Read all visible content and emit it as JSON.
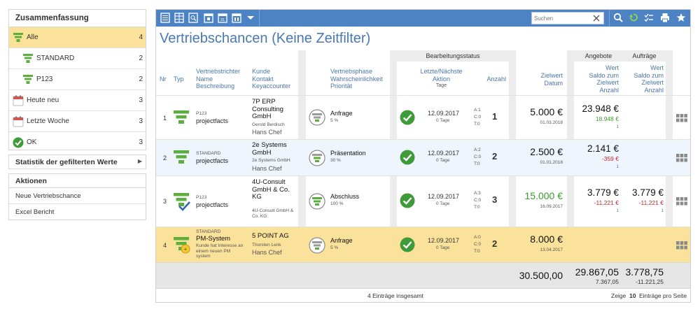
{
  "summary": {
    "title": "Zusammenfassung",
    "items": [
      {
        "label": "Alle",
        "count": "4"
      },
      {
        "label": "STANDARD",
        "count": "2"
      },
      {
        "label": "P123",
        "count": "2"
      },
      {
        "label": "Heute neu",
        "count": "3"
      },
      {
        "label": "Letzte Woche",
        "count": "3"
      },
      {
        "label": "OK",
        "count": "3"
      }
    ]
  },
  "stats": {
    "title": "Statistik der gefilterten Werte"
  },
  "actions": {
    "title": "Aktionen",
    "items": [
      "Neue Vertriebschance",
      "Excel Bericht"
    ]
  },
  "toolbar": {
    "search_placeholder": "Suchen"
  },
  "page_title": "Vertriebschancen (Keine Zeitfilter)",
  "groups": {
    "bearbeitungsstatus": "Bearbeitungsstatus",
    "angebote": "Angebote",
    "auftraege": "Aufträge"
  },
  "headers": {
    "nr": "Nr",
    "typ": "Typ",
    "vertrieb": [
      "Vertriebstrichter",
      "Name",
      "Beschreibung"
    ],
    "kunde": [
      "Kunde",
      "Kontakt",
      "Keyaccounter"
    ],
    "phase": [
      "Vertriebsphase",
      "Wahrscheinlichkeit",
      "Priorität"
    ],
    "aktion": [
      "Letzte/Nächste",
      "Aktion",
      "Tage"
    ],
    "anzahl": "Anzahl",
    "zielwert": [
      "Zielwert",
      "Datum"
    ],
    "angebote": [
      "Wert",
      "Saldo zum",
      "Zielwert",
      "Anzahl"
    ],
    "auftraege": [
      "Wert",
      "Saldo zum",
      "Zielwert",
      "Anzahl"
    ]
  },
  "rows": [
    {
      "nr": "1",
      "trichter": "P123",
      "name": "projectfacts",
      "beschreibung": "",
      "kunde": "7P ERP Consulting GmbH",
      "kontakt": "Gerold Berdisch",
      "keyaccounter": "Hans Chef",
      "phase": "Anfrage",
      "prob": "5 %",
      "date": "12.09.2017",
      "tage": "0 Tage",
      "abc": [
        "A:1",
        "C:0",
        "T:0"
      ],
      "anzahl": "1",
      "zielwert": "5.000 €",
      "zieldatum": "01.03.2018",
      "ang_wert": "23.948 €",
      "ang_saldo": "18.948 €",
      "ang_anzahl": "1",
      "auf_wert": "",
      "auf_saldo": "",
      "auf_anzahl": ""
    },
    {
      "nr": "2",
      "trichter": "STANDARD",
      "name": "projectfacts",
      "beschreibung": "",
      "kunde": "2e Systems GmbH",
      "kontakt": "2e Systems GmbH",
      "keyaccounter": "Hans Chef",
      "phase": "Präsentation",
      "prob": "30 %",
      "date": "12.09.2017",
      "tage": "0 Tage",
      "abc": [
        "A:2",
        "C:0",
        "T:0"
      ],
      "anzahl": "2",
      "zielwert": "2.500 €",
      "zieldatum": "01.01.2018",
      "ang_wert": "2.141 €",
      "ang_saldo": "-359 €",
      "ang_anzahl": "1",
      "auf_wert": "",
      "auf_saldo": "",
      "auf_anzahl": ""
    },
    {
      "nr": "3",
      "trichter": "P123",
      "name": "projectfacts",
      "beschreibung": "",
      "kunde": "4U-Consult GmbH & Co. KG",
      "kontakt": "4U-Consult GmbH & Co. KG",
      "keyaccounter": "",
      "phase": "Abschluss",
      "prob": "100 %",
      "date": "12.09.2017",
      "tage": "0 Tage",
      "abc": [
        "A:3",
        "C:0",
        "T:0"
      ],
      "anzahl": "3",
      "zielwert": "15.000 €",
      "zieldatum": "16.09.2017",
      "ang_wert": "3.779 €",
      "ang_saldo": "-11.221 €",
      "ang_anzahl": "1",
      "auf_wert": "3.779 €",
      "auf_saldo": "-11.221 €",
      "auf_anzahl": "1"
    },
    {
      "nr": "4",
      "trichter": "STANDARD",
      "name": "PM-System",
      "beschreibung": "Kunde hat Interesse an einem neuen PM system",
      "kunde": "5 POINT AG",
      "kontakt": "Thorsten Lenk",
      "keyaccounter": "Hans Chef",
      "phase": "Anfrage",
      "prob": "5 %",
      "date": "12.09.2017",
      "tage": "0 Tage",
      "abc": [
        "A:0",
        "C:0",
        "T:0"
      ],
      "anzahl": "2",
      "zielwert": "8.000 €",
      "zieldatum": "13.04.2017",
      "ang_wert": "",
      "ang_saldo": "",
      "ang_anzahl": "",
      "auf_wert": "",
      "auf_saldo": "",
      "auf_anzahl": ""
    }
  ],
  "totals": {
    "zielwert": "30.500,00",
    "angebote": "29.867,05",
    "angebote_saldo": "7.367,05",
    "auftraege": "3.778,75",
    "auftraege_saldo": "-11.221,25"
  },
  "pager": {
    "total": "4 Einträge insgesamt",
    "zeige": "Zeige",
    "size": "10",
    "suffix": "Einträge pro Seite"
  },
  "colors": {
    "accent_blue": "#4d83c5",
    "highlight": "#fbe29a",
    "funnel_green": "#5cae3f",
    "positive": "#3a9a2d",
    "negative": "#c0262d"
  }
}
